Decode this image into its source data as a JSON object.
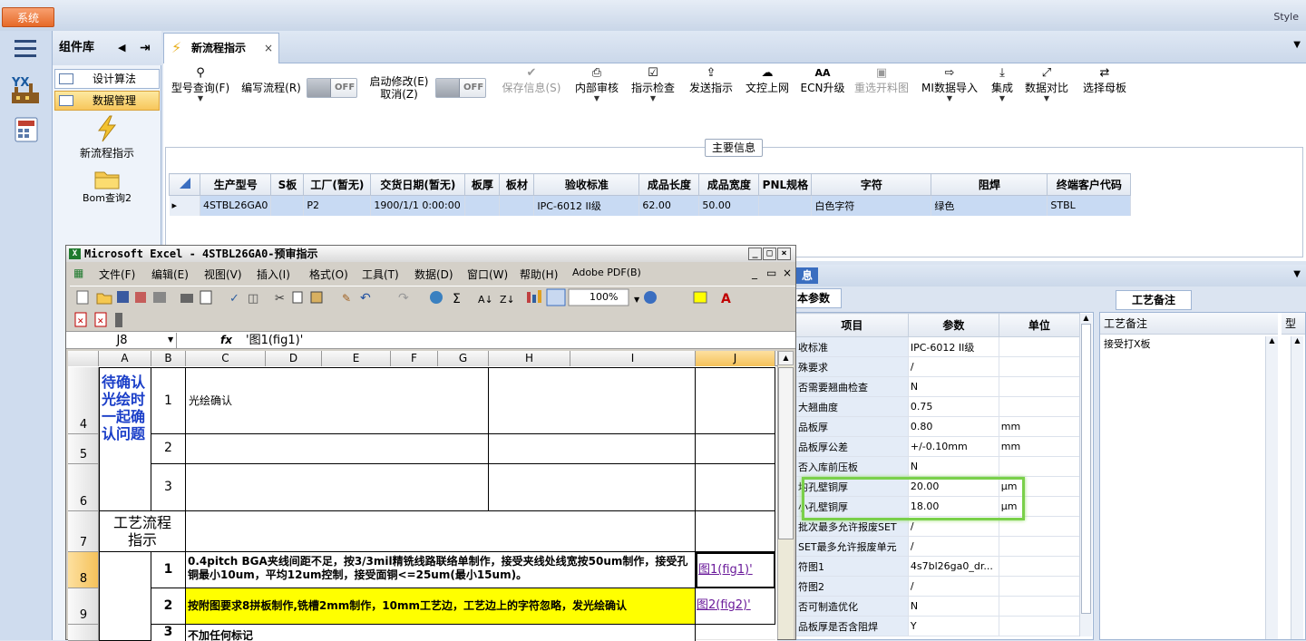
{
  "topbar": {
    "system_label": "系统",
    "style_label": "Style"
  },
  "panel": {
    "title": "组件库",
    "items": [
      {
        "label": "设计算法"
      },
      {
        "label": "数据管理"
      }
    ],
    "tools": [
      {
        "label": "新流程指示",
        "icon": "lightning-icon"
      },
      {
        "label": "Bom查询2",
        "icon": "folder-icon"
      }
    ]
  },
  "tabs": [
    {
      "label": "新流程指示"
    }
  ],
  "toolbar": {
    "buttons": [
      {
        "label": "型号查询(F)",
        "icon": "search-icon"
      },
      {
        "label": "编写流程(R)"
      },
      {
        "label": "启动修改(E)",
        "label2": "取消(Z)"
      },
      {
        "label": "保存信息(S)",
        "icon": "check-icon",
        "disabled": true
      },
      {
        "label": "内部审核",
        "icon": "printer-icon"
      },
      {
        "label": "指示检查",
        "icon": "checkbox-icon"
      },
      {
        "label": "发送指示",
        "icon": "upload-icon"
      },
      {
        "label": "文控上网",
        "icon": "cloud-upload-icon"
      },
      {
        "label": "ECN升级",
        "icon": "ecn-icon"
      },
      {
        "label": "重选开料图",
        "icon": "image-icon",
        "disabled": true
      },
      {
        "label": "MI数据导入",
        "icon": "import-icon"
      },
      {
        "label": "集成",
        "icon": "download-icon"
      },
      {
        "label": "数据对比",
        "icon": "compare-icon"
      },
      {
        "label": "选择母板",
        "icon": "shuffle-icon"
      }
    ],
    "toggle_off": "OFF"
  },
  "main_info": {
    "title": "主要信息",
    "columns": [
      "生产型号",
      "S板",
      "工厂(暂无)",
      "交货日期(暂无)",
      "板厚",
      "板材",
      "验收标准",
      "成品长度",
      "成品宽度",
      "PNL规格",
      "字符",
      "阻焊",
      "终端客户代码"
    ],
    "rows": [
      [
        "4STBL26GA0",
        "",
        "P2",
        "1900/1/1 0:00:00",
        "",
        "",
        "IPC-6012 II级",
        "62.00",
        "50.00",
        "",
        "白色字符",
        "绿色",
        "STBL"
      ]
    ]
  },
  "params": {
    "header": "息",
    "tab": "本参数",
    "columns": [
      "项目",
      "参数",
      "单位"
    ],
    "rows": [
      [
        "收标准",
        "IPC-6012 II级",
        ""
      ],
      [
        "殊要求",
        "/",
        ""
      ],
      [
        "否需要翘曲检查",
        "N",
        ""
      ],
      [
        "大翘曲度",
        "0.75",
        ""
      ],
      [
        "品板厚",
        "0.80",
        "mm"
      ],
      [
        "品板厚公差",
        "+/-0.10mm",
        "mm"
      ],
      [
        "否入库前压板",
        "N",
        ""
      ],
      [
        "均孔壁铜厚",
        "20.00",
        "μm"
      ],
      [
        "小孔壁铜厚",
        "18.00",
        "μm"
      ],
      [
        "批次最多允许报废SET",
        "/",
        ""
      ],
      [
        "SET最多允许报废单元",
        "/",
        ""
      ],
      [
        "符图1",
        "4s7bl26ga0_dr...",
        ""
      ],
      [
        "符图2",
        "/",
        ""
      ],
      [
        "否可制造优化",
        "N",
        ""
      ],
      [
        "品板厚是否含阻焊",
        "Y",
        ""
      ]
    ],
    "remark_tab": "工艺备注",
    "remark_header": "工艺备注",
    "remark_header2": "型",
    "remark_value": "接受打X板"
  },
  "excel": {
    "title": "Microsoft Excel - 4STBL26GA0-预审指示",
    "menu": [
      "文件(F)",
      "编辑(E)",
      "视图(V)",
      "插入(I)",
      "格式(O)",
      "工具(T)",
      "数据(D)",
      "窗口(W)",
      "帮助(H)",
      "Adobe PDF(B)"
    ],
    "zoom": "100%",
    "name_box": "J8",
    "fx_label": "fx",
    "formula": "'图1(fig1)'",
    "columns": [
      "A",
      "B",
      "C",
      "D",
      "E",
      "F",
      "G",
      "H",
      "I",
      "J"
    ],
    "rows": [
      "4",
      "5",
      "6",
      "7",
      "8",
      "9"
    ],
    "cells": {
      "a4": "待确认光绘时一起确认问题",
      "b4": "1",
      "b5": "2",
      "b6": "3",
      "c4": "光绘确认",
      "a7": "工艺流程指示",
      "b8": "1",
      "c8": "0.4pitch BGA夹线间距不足，按3/3mil精铣线路联络单制作，接受夹线处线宽按50um制作，接受孔铜最小10um，平均12um控制，接受面铜<=25um(最小15um)。",
      "j8": "图1(fig1)'",
      "b9": "2",
      "c9": "按附图要求8拼板制作,铣槽2mm制作，10mm工艺边，工艺边上的字符忽略，发光绘确认",
      "j9": "图2(fig2)'",
      "b10": "3",
      "c10": "不加任何标记"
    }
  },
  "colors": {
    "accent": "#f7c65b",
    "selection": "#c8daf3",
    "highlight": "#ffff00",
    "green_box": "#7ad04a"
  }
}
